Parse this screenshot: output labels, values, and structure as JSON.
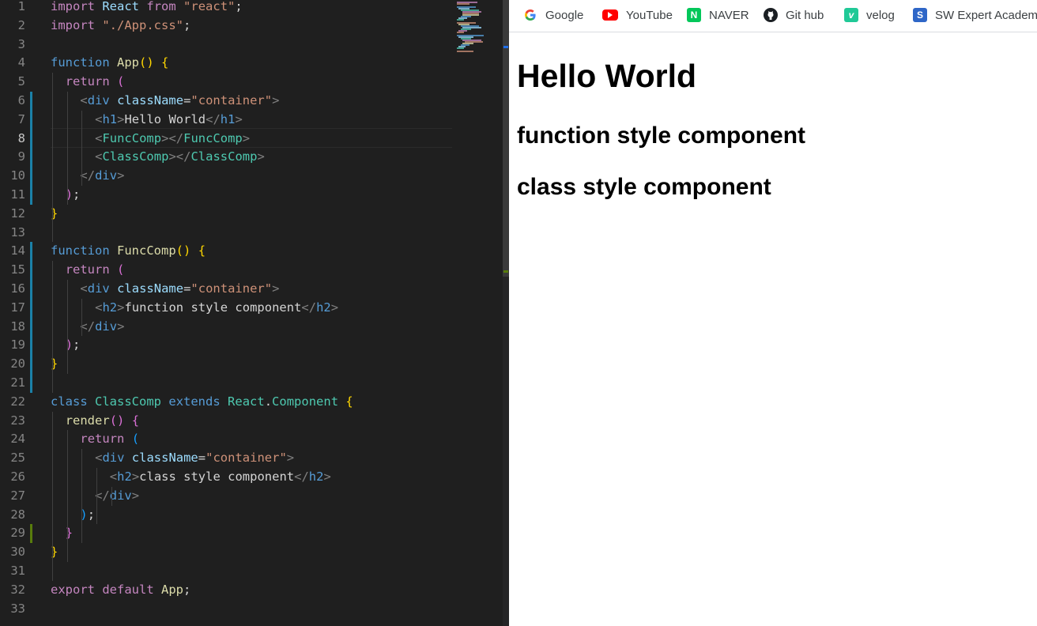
{
  "editor": {
    "line_numbers": [
      "1",
      "2",
      "3",
      "4",
      "5",
      "6",
      "7",
      "8",
      "9",
      "10",
      "11",
      "12",
      "13",
      "14",
      "15",
      "16",
      "17",
      "18",
      "19",
      "20",
      "21",
      "22",
      "23",
      "24",
      "25",
      "26",
      "27",
      "28",
      "29",
      "30",
      "31",
      "32",
      "33"
    ],
    "active_line": "8",
    "t": {
      "import": "import",
      "react_ident": "React",
      "from": "from",
      "react_str": "\"react\"",
      "semi": ";",
      "css_str": "\"./App.css\"",
      "function": "function",
      "app": "App",
      "paren_open": "(",
      "paren_close": ")",
      "brace_open": "{",
      "brace_close": "}",
      "return": "return",
      "lt": "<",
      "lts": "</",
      "gt": ">",
      "div": "div",
      "className": "className",
      "eq": "=",
      "container_str": "\"container\"",
      "h1": "h1",
      "h2": "h2",
      "hello_world": "Hello World",
      "funccomp": "FuncComp",
      "classcomp": "ClassComp",
      "function_style": "function style component",
      "class_style": "class style component",
      "class": "class",
      "extends": "extends",
      "dot": ".",
      "component": "Component",
      "render": "render",
      "export": "export",
      "default": "default",
      "space": " "
    }
  },
  "bookmarks": [
    {
      "label": "Google",
      "icon": "google-icon"
    },
    {
      "label": "YouTube",
      "icon": "youtube-icon"
    },
    {
      "label": "NAVER",
      "icon": "naver-icon"
    },
    {
      "label": "Git hub",
      "icon": "github-icon"
    },
    {
      "label": "velog",
      "icon": "velog-icon"
    },
    {
      "label": "SW Expert Academy",
      "icon": "sw-expert-academy-icon"
    }
  ],
  "page": {
    "h1": "Hello World",
    "h2_function": "function style component",
    "h2_class": "class style component"
  },
  "colors": {
    "editor_bg": "#1f1f1f",
    "keyword": "#c586c0",
    "string": "#ce9178",
    "function": "#dcdcaa",
    "storage": "#569cd6",
    "type": "#4ec9b0",
    "variable": "#9cdcfe",
    "browser_bg": "#ffffff"
  }
}
